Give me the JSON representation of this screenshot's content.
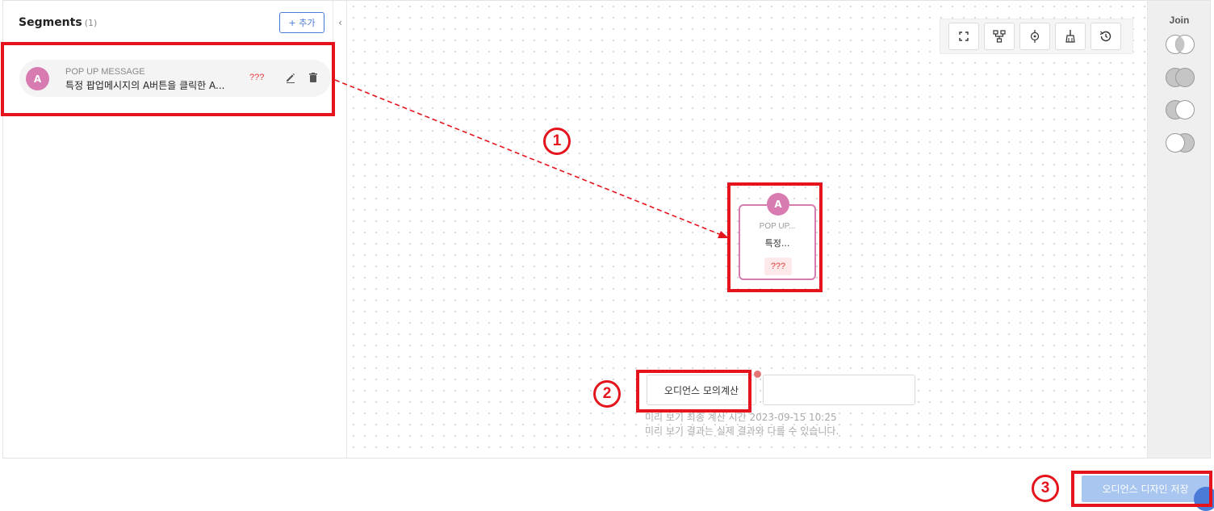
{
  "sidebar": {
    "title": "Segments",
    "count": "(1)",
    "add_label": "+ 추가",
    "collapse_glyph": "‹",
    "segment": {
      "avatar": "A",
      "type": "POP UP MESSAGE",
      "description": "특정 팝업메시지의 A버튼을 클릭한 A...",
      "count": "???"
    }
  },
  "toolbar": {
    "icons": [
      "fullscreen-icon",
      "tree-layout-icon",
      "center-icon",
      "clear-icon",
      "history-icon"
    ]
  },
  "node": {
    "avatar": "A",
    "type": "POP UP...",
    "description": "특정...",
    "count": "???"
  },
  "simulation": {
    "button_label": "오디언스 모의계산",
    "input_value": "",
    "note_line1": "미리 보기 최종 계산 시간 2023-09-15 10:25",
    "note_line2": "미리 보기 결과는 실제 결과와 다를 수 있습니다."
  },
  "join": {
    "title": "Join",
    "options": [
      "intersection",
      "union",
      "left-difference",
      "right-difference"
    ]
  },
  "footer": {
    "save_label": "오디언스 디자인 저장"
  },
  "annotations": {
    "step1": "1",
    "step2": "2",
    "step3": "3"
  },
  "colors": {
    "accent": "#4a7bd8",
    "segment": "#d87bb0",
    "highlight": "#e5141c"
  }
}
